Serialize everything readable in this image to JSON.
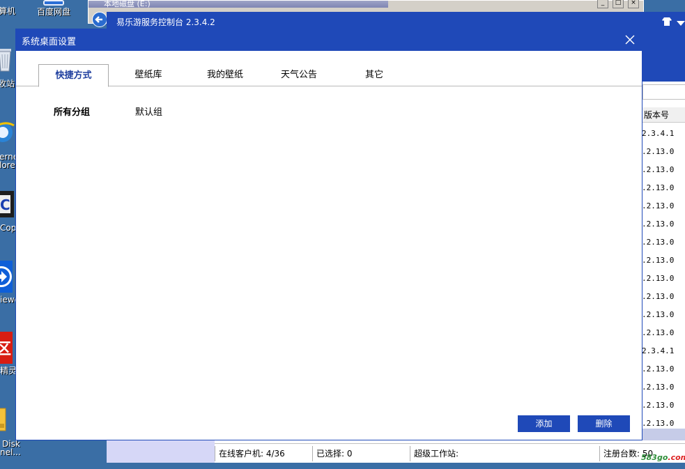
{
  "desktop": {
    "icons": [
      {
        "label": "算机",
        "icon": "computer-icon"
      },
      {
        "label": "百度网盘",
        "icon": "cloud-drive-icon"
      },
      {
        "label": "收站",
        "icon": "recycle-bin-icon"
      },
      {
        "label_line1": "ernet",
        "label_line2": "lorer",
        "icon": "internet-explorer-icon"
      },
      {
        "label": "Copy",
        "icon": "copy-tool-icon"
      },
      {
        "label": "iewe",
        "icon": "teamviewer-icon"
      },
      {
        "label": "精灵",
        "icon": "red-app-icon"
      },
      {
        "label_line1": "Disk",
        "label_line2": "nel...",
        "icon": "disk-panel-icon"
      }
    ]
  },
  "explorer_window": {
    "title": "本地磁盘 (E:)"
  },
  "console": {
    "title": "易乐游服务控制台 2.3.4.2",
    "grid": {
      "column_header": "版本号",
      "rows": [
        "2.3.4.1",
        ".2.13.0",
        ".2.13.0",
        ".2.13.0",
        ".2.13.0",
        ".2.13.0",
        ".2.13.0",
        ".2.13.0",
        ".2.13.0",
        ".2.13.0",
        ".2.13.0",
        "2.3.4.1",
        ".2.13.0",
        ".2.13.0",
        ".2.13.0",
        ".2.13.0"
      ]
    },
    "status": {
      "online_clients": "在线客户机: 4/36",
      "selected": "已选择: 0",
      "super_workstation": "超级工作站:",
      "registered_count": "注册台数: 50"
    }
  },
  "dialog": {
    "title": "系统桌面设置",
    "tabs": [
      "快捷方式",
      "壁纸库",
      "我的壁纸",
      "天气公告",
      "其它"
    ],
    "active_tab": "快捷方式",
    "group_label": "所有分组",
    "group_item": "默认组",
    "add_button": "添加",
    "delete_button": "删除"
  },
  "watermark": {
    "part1": "583go",
    "part2": ".com"
  }
}
